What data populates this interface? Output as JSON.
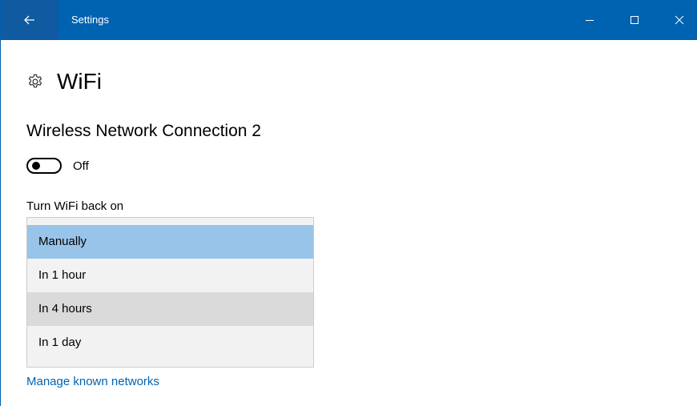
{
  "window": {
    "title": "Settings",
    "accent_color": "#0063b1"
  },
  "titlebar": {
    "back_icon": "arrow-left-icon",
    "minimize_icon": "minimize-icon",
    "maximize_icon": "maximize-icon",
    "close_icon": "close-icon"
  },
  "page": {
    "icon": "gear-icon",
    "title": "WiFi"
  },
  "adapter": {
    "name": "Wireless Network Connection 2",
    "toggle_state": "Off"
  },
  "turn_back_on": {
    "label": "Turn WiFi back on",
    "options": [
      {
        "label": "Manually",
        "state": "selected"
      },
      {
        "label": "In 1 hour",
        "state": "normal"
      },
      {
        "label": "In 4 hours",
        "state": "hover"
      },
      {
        "label": "In 1 day",
        "state": "normal"
      }
    ]
  },
  "links": {
    "manage_known_networks": "Manage known networks"
  },
  "colors": {
    "selected_item": "#99c4ea",
    "hover_item": "#dadada",
    "list_background": "#f2f2f2",
    "link": "#0063b1"
  }
}
